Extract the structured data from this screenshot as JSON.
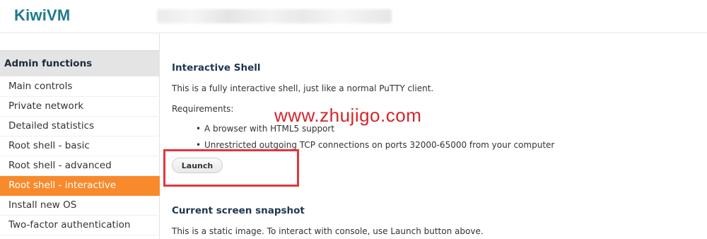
{
  "header": {
    "logo": "KiwiVM"
  },
  "sidebar": {
    "heading": "Admin functions",
    "items": [
      {
        "label": "Main controls"
      },
      {
        "label": "Private network"
      },
      {
        "label": "Detailed statistics"
      },
      {
        "label": "Root shell - basic"
      },
      {
        "label": "Root shell - advanced"
      },
      {
        "label": "Root shell - interactive",
        "active": true
      },
      {
        "label": "Install new OS"
      },
      {
        "label": "Two-factor authentication"
      }
    ]
  },
  "main": {
    "shell_title": "Interactive Shell",
    "shell_desc": "This is a fully interactive shell, just like a normal PuTTY client.",
    "requirements_label": "Requirements:",
    "requirements": [
      "A browser with HTML5 support",
      "Unrestricted outgoing TCP connections on ports 32000-65000 from your computer"
    ],
    "launch_label": "Launch",
    "snapshot_title": "Current screen snapshot",
    "snapshot_desc": "This is a static image. To interact with console, use Launch button above."
  },
  "watermark": "www.zhujigo.com",
  "colors": {
    "accent": "#f88a2c",
    "logo": "#1f7a8c",
    "heading": "#1e3650",
    "highlight": "#e0373d"
  }
}
